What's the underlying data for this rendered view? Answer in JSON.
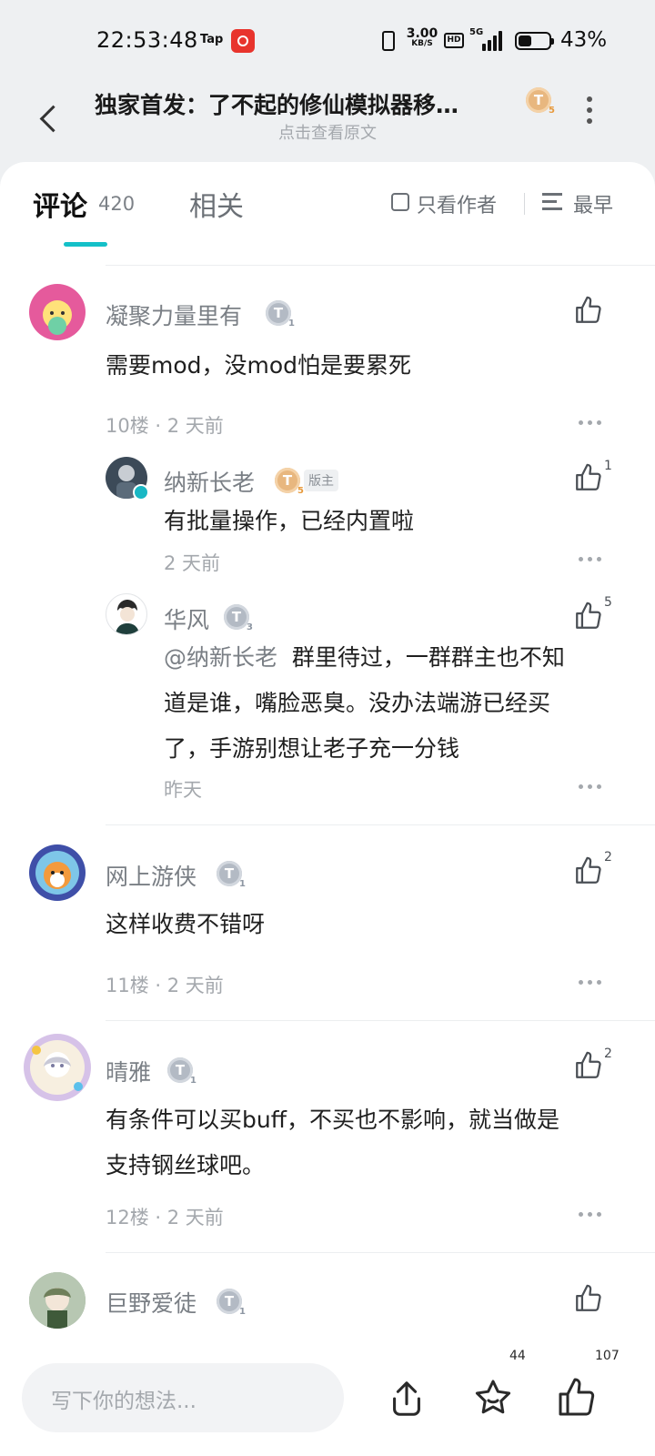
{
  "status_bar": {
    "time": "22:53:48",
    "tap_label": "Tap",
    "net_speed": "3.00",
    "net_unit": "KB/S",
    "hd": "HD",
    "network": "5G",
    "battery_pct": "43%",
    "battery_level": 0.43
  },
  "header": {
    "title": "独家首发：了不起的修仙模拟器移…",
    "subtitle": "点击查看原文",
    "badge_letter": "T",
    "badge_level": "5"
  },
  "tabs": {
    "comments_label": "评论",
    "comments_count": "420",
    "related_label": "相关",
    "author_only_label": "只看作者",
    "sort_label": "最早"
  },
  "comments": [
    {
      "user": "凝聚力量里有",
      "level": "1",
      "text": "需要mod，没mod怕是要累死",
      "meta": "10楼 · 2 天前",
      "likes": "",
      "avatar_color": "#e55a9c",
      "replies": [
        {
          "user": "纳新长老",
          "level": "5",
          "tag": "版主",
          "text": "有批量操作，已经内置啦",
          "meta": "2 天前",
          "likes": "1",
          "avatar_color": "#3c4a58"
        },
        {
          "user": "华风",
          "level": "3",
          "mention": "@纳新长老",
          "text_line1": "群里待过，一群群主也不知",
          "text_line2": "道是谁，嘴脸恶臭。没办法端游已经买",
          "text_line3": "了，手游别想让老子充一分钱",
          "meta": "昨天",
          "likes": "5",
          "avatar_color": "#2a2a2a"
        }
      ]
    },
    {
      "user": "网上游侠",
      "level": "1",
      "text": "这样收费不错呀",
      "meta": "11楼 · 2 天前",
      "likes": "2",
      "avatar_color": "#3f4fa8"
    },
    {
      "user": "晴雅",
      "level": "1",
      "text_line1": "有条件可以买buff，不买也不影响，就当做是",
      "text_line2": "支持钢丝球吧。",
      "meta": "12楼 · 2 天前",
      "likes": "2",
      "avatar_color": "#d6c2e8"
    },
    {
      "user": "巨野爱徒",
      "level": "1",
      "likes": "",
      "avatar_color": "#8fa88a"
    }
  ],
  "bottom_bar": {
    "placeholder": "写下你的想法...",
    "favorites": "44",
    "likes": "107"
  },
  "colors": {
    "accent": "#14c0c8",
    "badge_gold": "#e8b77f",
    "badge_gray": "#b3bac4"
  },
  "icons": [
    "back-icon",
    "more-vertical-icon",
    "checkbox-icon",
    "sort-icon",
    "thumbs-up-icon",
    "more-horizontal-icon",
    "share-icon",
    "star-icon"
  ]
}
